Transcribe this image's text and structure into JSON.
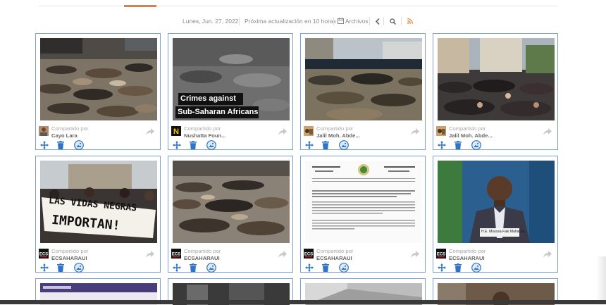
{
  "toolbar": {
    "date": "Lunes, Jun. 27, 2022",
    "next_update": "Próxima actualización en 10 horas",
    "archives": "Archivos"
  },
  "colors": {
    "card_border": "#7d9fd6",
    "action_blue": "#2f73c9",
    "rss_orange": "#f07a22",
    "accent": "#c8845a"
  },
  "cards": [
    {
      "shared_label": "Compartido por",
      "author": "Cayo Lara",
      "image": "crowd-lying-street-photo"
    },
    {
      "shared_label": "Compartido por",
      "author": "Nushatta Foun...",
      "image": "video-still",
      "overlay": [
        "Crimes against",
        "Sub-Saharan Africans"
      ]
    },
    {
      "shared_label": "Compartido por",
      "author": "Jalil Moh. Abde...",
      "image": "police-crowd-photo"
    },
    {
      "shared_label": "Compartido por",
      "author": "Jalil Moh. Abde...",
      "image": "protest-sitting-crowd-photo"
    },
    {
      "shared_label": "Compartido por",
      "author": "ECSAHARAUI",
      "image": "protest-banner-photo",
      "banner": [
        "LAS VIDAS NEGRAS",
        "IMPORTAN!"
      ]
    },
    {
      "shared_label": "Compartido por",
      "author": "ECSAHARAUI",
      "image": "bodies-street-photo"
    },
    {
      "shared_label": "Compartido por",
      "author": "ECSAHARAUI",
      "image": "african-union-document"
    },
    {
      "shared_label": "Compartido por",
      "author": "ECSAHARAUI",
      "image": "official-speaking-photo",
      "caption": "H.E. Moussa Faki Mahamat"
    }
  ]
}
